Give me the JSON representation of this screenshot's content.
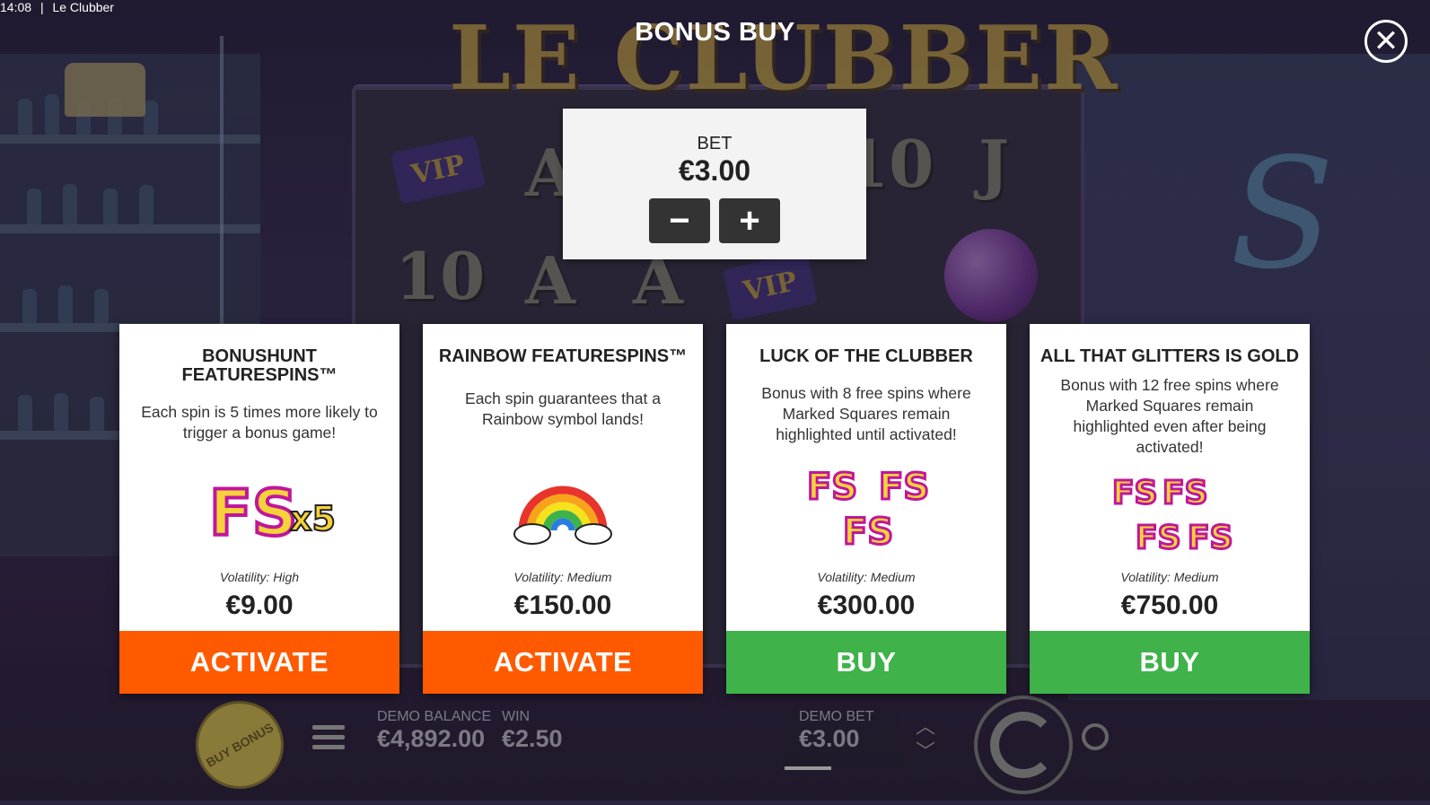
{
  "status_bar": {
    "time": "14:08",
    "separator": "|",
    "app_title": "Le Clubber"
  },
  "background": {
    "logo_text": "LE CLUBBER",
    "reel_symbols": [
      "A",
      "10",
      "J",
      "10",
      "A",
      "A"
    ],
    "vip_text": "VIP",
    "neon_sign": "S"
  },
  "dialog": {
    "title": "BONUS BUY",
    "close_icon": "close-icon",
    "bet": {
      "label": "BET",
      "value": "€3.00",
      "decrease_icon": "minus-icon",
      "increase_icon": "plus-icon"
    }
  },
  "cards": [
    {
      "title": "BONUSHUNT FEATURESPINS™",
      "description": "Each spin is 5 times more likely to trigger a bonus game!",
      "art": "FSx5",
      "volatility": "Volatility: High",
      "price": "€9.00",
      "action": "ACTIVATE",
      "action_color": "#ff5a00"
    },
    {
      "title": "RAINBOW FEATURESPINS™",
      "description": "Each spin guarantees that a Rainbow symbol lands!",
      "art": "rainbow-icon",
      "volatility": "Volatility: Medium",
      "price": "€150.00",
      "action": "ACTIVATE",
      "action_color": "#ff5a00"
    },
    {
      "title": "LUCK OF THE CLUBBER",
      "description": "Bonus with 8 free spins where Marked Squares remain highlighted until activated!",
      "art": "FS",
      "volatility": "Volatility: Medium",
      "price": "€300.00",
      "action": "BUY",
      "action_color": "#3fb24a"
    },
    {
      "title": "ALL THAT GLITTERS IS GOLD",
      "description": "Bonus with 12 free spins where Marked Squares remain highlighted even after being activated!",
      "art": "FS",
      "volatility": "Volatility: Medium",
      "price": "€750.00",
      "action": "BUY",
      "action_color": "#3fb24a"
    }
  ],
  "hud": {
    "buy_bonus": "BUY BONUS",
    "balance_label": "DEMO BALANCE",
    "balance_value": "€4,892.00",
    "win_label": "WIN",
    "win_value": "€2.50",
    "bet_label": "DEMO BET",
    "bet_value": "€3.00"
  }
}
